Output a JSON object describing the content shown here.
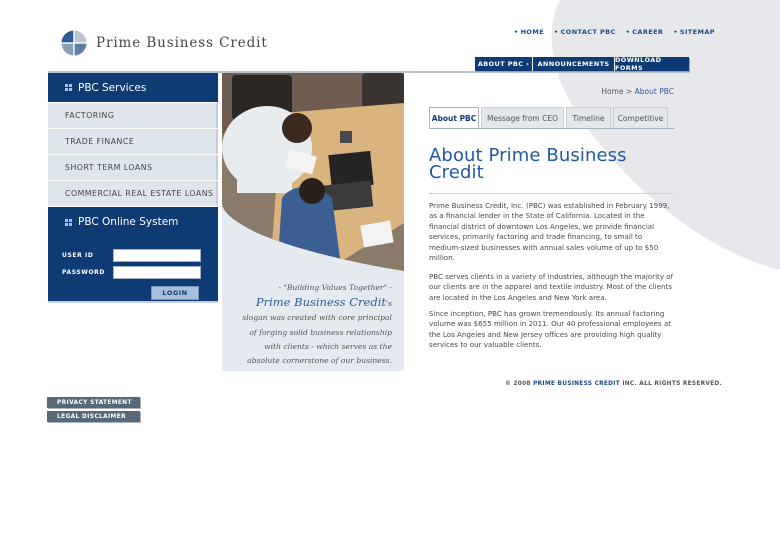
{
  "brand": {
    "logo_text": "Prime Business Credit"
  },
  "top_links": [
    "HOME",
    "CONTACT PBC",
    "CAREER",
    "SITEMAP"
  ],
  "main_nav": [
    "ABOUT PBC ›",
    "ANNOUNCEMENTS",
    "DOWNLOAD FORMS"
  ],
  "services": {
    "heading": "PBC Services",
    "items": [
      "FACTORING",
      "TRADE FINANCE",
      "SHORT TERM LOANS",
      "COMMERCIAL REAL ESTATE LOANS"
    ]
  },
  "online_system": {
    "heading": "PBC Online System",
    "user_id_label": "USER ID",
    "password_label": "PASSWORD",
    "user_id_value": "",
    "password_value": "",
    "login_label": "LOGIN"
  },
  "slogan": {
    "quote": "- \"Building Values Together\" -",
    "brand": "Prime Business Credit",
    "suffix": "'s",
    "lines": [
      "slogan was created with core principal",
      "of forging solid business relationship",
      "with clients - which serves as the",
      "absolute cornerstone of our business."
    ]
  },
  "footer_buttons": [
    "PRIVACY STATEMENT",
    "LEGAL DISCLAIMER"
  ],
  "breadcrumb": {
    "home": "Home",
    "sep": ">",
    "current": "About PBC"
  },
  "tabs": [
    "About PBC",
    "Message from CEO",
    "Timeline",
    "Competitive"
  ],
  "content": {
    "title": "About Prime Business Credit",
    "paragraphs": [
      "Prime Business Credit, Inc. (PBC) was established in February 1999, as a financial lender in the State of California. Located in the financial district of downtown Los Angeles, we provide financial services, primarily factoring and trade financing, to small to medium-sized businesses with annual sales volume of up to $50 million.",
      "PBC serves clients in a variety of industries, although the majority of our clients are in the apparel and textile industry. Most of the clients are located in the Los Angeles and New York area.",
      "Since inception, PBC has grown tremendously. Its annual factoring volume was $655 million in 2011. Our 40 professional employees at the Los Angeles and New Jersey offices are providing high quality services to our valuable clients."
    ]
  },
  "copyright": {
    "prefix": "© 2008",
    "brand": "PRIME BUSINESS CREDIT",
    "suffix": "INC. ALL RIGHTS RESERVED."
  },
  "colors": {
    "navy": "#0e3b73",
    "link_blue": "#1f5aa3",
    "swoosh": "#e5e7ea"
  }
}
